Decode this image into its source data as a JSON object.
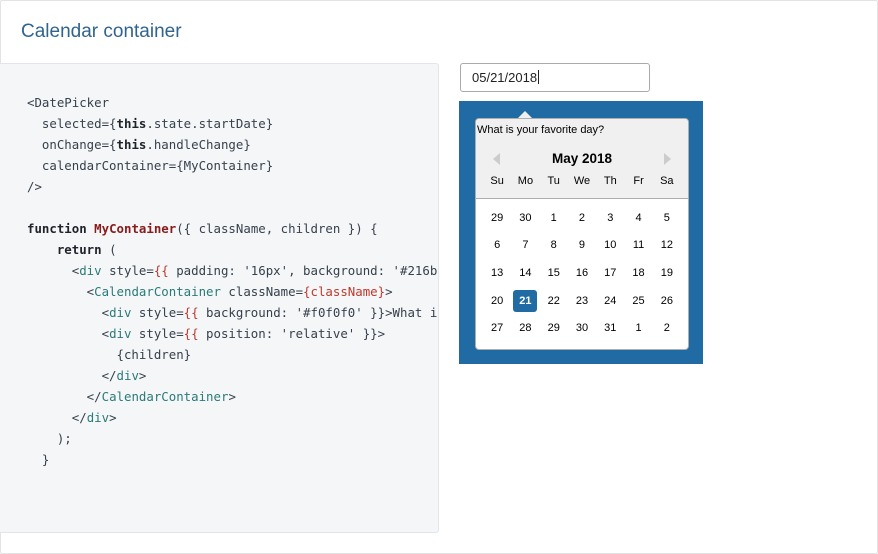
{
  "section": {
    "title": "Calendar container"
  },
  "code": {
    "lines": [
      [
        {
          "t": "<DatePicker",
          "c": ""
        }
      ],
      [
        {
          "t": "  selected={",
          "c": ""
        },
        {
          "t": "this",
          "c": "kw"
        },
        {
          "t": ".state.startDate}",
          "c": ""
        }
      ],
      [
        {
          "t": "  onChange={",
          "c": ""
        },
        {
          "t": "this",
          "c": "kw"
        },
        {
          "t": ".handleChange}",
          "c": ""
        }
      ],
      [
        {
          "t": "  calendarContainer={MyContainer}",
          "c": ""
        }
      ],
      [
        {
          "t": "/>",
          "c": ""
        }
      ],
      [
        {
          "t": "",
          "c": ""
        }
      ],
      [
        {
          "t": "function",
          "c": "kw"
        },
        {
          "t": " ",
          "c": ""
        },
        {
          "t": "MyContainer",
          "c": "fn"
        },
        {
          "t": "({ className, children }) {",
          "c": ""
        }
      ],
      [
        {
          "t": "    ",
          "c": ""
        },
        {
          "t": "return",
          "c": "kw"
        },
        {
          "t": " (",
          "c": ""
        }
      ],
      [
        {
          "t": "      <",
          "c": ""
        },
        {
          "t": "div",
          "c": "tag"
        },
        {
          "t": " style=",
          "c": ""
        },
        {
          "t": "{{",
          "c": "brace"
        },
        {
          "t": " padding: '16px', background: '#216b",
          "c": ""
        }
      ],
      [
        {
          "t": "        <",
          "c": ""
        },
        {
          "t": "CalendarContainer",
          "c": "tag"
        },
        {
          "t": " className=",
          "c": ""
        },
        {
          "t": "{className}",
          "c": "brace"
        },
        {
          "t": ">",
          "c": ""
        }
      ],
      [
        {
          "t": "          <",
          "c": ""
        },
        {
          "t": "div",
          "c": "tag"
        },
        {
          "t": " style=",
          "c": ""
        },
        {
          "t": "{{",
          "c": "brace"
        },
        {
          "t": " background: '#f0f0f0' }}>What i",
          "c": ""
        }
      ],
      [
        {
          "t": "          <",
          "c": ""
        },
        {
          "t": "div",
          "c": "tag"
        },
        {
          "t": " style=",
          "c": ""
        },
        {
          "t": "{{",
          "c": "brace"
        },
        {
          "t": " position: 'relative' }}>",
          "c": ""
        }
      ],
      [
        {
          "t": "            {children}",
          "c": ""
        }
      ],
      [
        {
          "t": "          </",
          "c": ""
        },
        {
          "t": "div",
          "c": "tag"
        },
        {
          "t": ">",
          "c": ""
        }
      ],
      [
        {
          "t": "        </",
          "c": ""
        },
        {
          "t": "CalendarContainer",
          "c": "tag"
        },
        {
          "t": ">",
          "c": ""
        }
      ],
      [
        {
          "t": "      </",
          "c": ""
        },
        {
          "t": "div",
          "c": "tag"
        },
        {
          "t": ">",
          "c": ""
        }
      ],
      [
        {
          "t": "    );",
          "c": ""
        }
      ],
      [
        {
          "t": "  }",
          "c": ""
        }
      ]
    ]
  },
  "datepicker": {
    "input_value": "05/21/2018",
    "favorite_text": "What is your favorite day?",
    "month_label": "May 2018",
    "weekdays": [
      "Su",
      "Mo",
      "Tu",
      "We",
      "Th",
      "Fr",
      "Sa"
    ],
    "selected_day": "21",
    "weeks": [
      [
        "29",
        "30",
        "1",
        "2",
        "3",
        "4",
        "5"
      ],
      [
        "6",
        "7",
        "8",
        "9",
        "10",
        "11",
        "12"
      ],
      [
        "13",
        "14",
        "15",
        "16",
        "17",
        "18",
        "19"
      ],
      [
        "20",
        "21",
        "22",
        "23",
        "24",
        "25",
        "26"
      ],
      [
        "27",
        "28",
        "29",
        "30",
        "31",
        "1",
        "2"
      ]
    ]
  }
}
